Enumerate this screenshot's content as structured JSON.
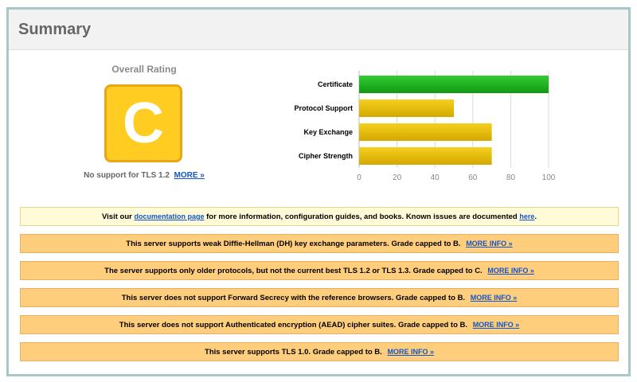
{
  "header": {
    "title": "Summary"
  },
  "rating": {
    "label": "Overall Rating",
    "grade": "C",
    "note": "No support for TLS 1.2",
    "more_link": "MORE »",
    "grade_color": "#ffcc22"
  },
  "chart_data": {
    "type": "bar",
    "orientation": "horizontal",
    "categories": [
      "Certificate",
      "Protocol Support",
      "Key Exchange",
      "Cipher Strength"
    ],
    "values": [
      100,
      50,
      70,
      70
    ],
    "colors": [
      "#22bb22",
      "#e0b000",
      "#e0b000",
      "#e0b000"
    ],
    "xlim": [
      0,
      100
    ],
    "xticks": [
      "0",
      "20",
      "40",
      "60",
      "80",
      "100"
    ],
    "grid": true
  },
  "info_notice": {
    "prefix": "Visit our ",
    "link1": "documentation page",
    "middle": " for more information, configuration guides, and books. Known issues are documented ",
    "link2": "here",
    "suffix": "."
  },
  "warnings": [
    {
      "text": "This server supports weak Diffie-Hellman (DH) key exchange parameters. Grade capped to B.",
      "link": "MORE INFO »"
    },
    {
      "text": "The server supports only older protocols, but not the current best TLS 1.2 or TLS 1.3. Grade capped to C.",
      "link": "MORE INFO »"
    },
    {
      "text": "This server does not support Forward Secrecy with the reference browsers. Grade capped to B.",
      "link": "MORE INFO »"
    },
    {
      "text": "This server does not support Authenticated encryption (AEAD) cipher suites. Grade capped to B.",
      "link": "MORE INFO »"
    },
    {
      "text": "This server supports TLS 1.0. Grade capped to B.",
      "link": "MORE INFO »"
    }
  ]
}
